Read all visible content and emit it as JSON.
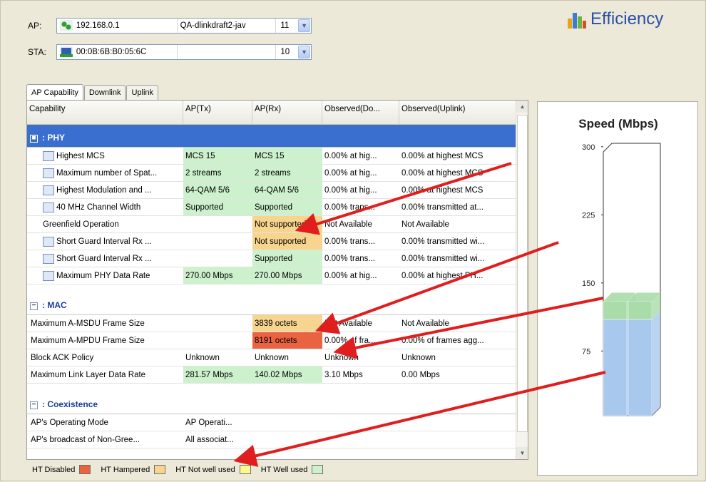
{
  "ap": {
    "label": "AP:",
    "ip": "192.168.0.1",
    "name": "QA-dlinkdraft2-jav",
    "channel": "11"
  },
  "sta": {
    "label": "STA:",
    "mac": "00:0B:6B:B0:05:6C",
    "name": "",
    "channel": "10"
  },
  "brand": {
    "title": "Efficiency"
  },
  "tabs": [
    {
      "label": "AP Capability"
    },
    {
      "label": "Downlink"
    },
    {
      "label": "Uplink"
    }
  ],
  "columns": [
    "Capability",
    "AP(Tx)",
    "AP(Rx)",
    "Observed(Do...",
    "Observed(Uplink)"
  ],
  "sections": {
    "phy": {
      "title": ": PHY"
    },
    "mac": {
      "title": ": MAC"
    },
    "coex": {
      "title": ": Coexistence"
    }
  },
  "phy_rows": [
    {
      "cap": "Highest MCS",
      "tx": "MCS 15",
      "rx": "MCS 15",
      "obs_down": "0.00% at hig...",
      "obs_up": "0.00% at highest MCS",
      "icon": true,
      "tx_c": "green",
      "rx_c": "green"
    },
    {
      "cap": "Maximum number of Spat...",
      "tx": "2 streams",
      "rx": "2 streams",
      "obs_down": "0.00% at hig...",
      "obs_up": "0.00% at highest MCS",
      "icon": true,
      "tx_c": "green",
      "rx_c": "green"
    },
    {
      "cap": "Highest Modulation and ...",
      "tx": "64-QAM 5/6",
      "rx": "64-QAM 5/6",
      "obs_down": "0.00% at hig...",
      "obs_up": "0.00% at highest MCS",
      "icon": true,
      "tx_c": "green",
      "rx_c": "green"
    },
    {
      "cap": "40 MHz Channel Width",
      "tx": "Supported",
      "rx": "Supported",
      "obs_down": "0.00% trans...",
      "obs_up": "0.00% transmitted at...",
      "icon": true,
      "tx_c": "green",
      "rx_c": "green"
    },
    {
      "cap": "Greenfield Operation",
      "tx": "",
      "rx": "Not supported",
      "obs_down": "Not Available",
      "obs_up": "Not Available",
      "icon": false,
      "tx_c": "",
      "rx_c": "orange"
    },
    {
      "cap": "Short Guard Interval Rx ...",
      "tx": "",
      "rx": "Not supported",
      "obs_down": "0.00% trans...",
      "obs_up": "0.00% transmitted wi...",
      "icon": true,
      "tx_c": "",
      "rx_c": "orange"
    },
    {
      "cap": "Short Guard Interval Rx ...",
      "tx": "",
      "rx": "Supported",
      "obs_down": "0.00% trans...",
      "obs_up": "0.00% transmitted wi...",
      "icon": true,
      "tx_c": "",
      "rx_c": "green"
    },
    {
      "cap": "Maximum PHY Data Rate",
      "tx": "270.00 Mbps",
      "rx": "270.00 Mbps",
      "obs_down": "0.00% at hig...",
      "obs_up": "0.00% at highest PH...",
      "icon": true,
      "tx_c": "green",
      "rx_c": "green"
    }
  ],
  "mac_rows": [
    {
      "cap": "Maximum A-MSDU Frame Size",
      "tx": "",
      "rx": "3839 octets",
      "obs_down": "Not Available",
      "obs_up": "Not Available",
      "tx_c": "",
      "rx_c": "orange"
    },
    {
      "cap": "Maximum A-MPDU Frame Size",
      "tx": "",
      "rx": "8191 octets",
      "obs_down": "0.00% of fra...",
      "obs_up": "0.00% of frames agg...",
      "tx_c": "",
      "rx_c": "red"
    },
    {
      "cap": "Block ACK Policy",
      "tx": "Unknown",
      "rx": "Unknown",
      "obs_down": "Unknown",
      "obs_up": "Unknown",
      "tx_c": "",
      "rx_c": ""
    },
    {
      "cap": "Maximum Link Layer Data Rate",
      "tx": "281.57 Mbps",
      "rx": "140.02 Mbps",
      "obs_down": "3.10 Mbps",
      "obs_up": "0.00 Mbps",
      "tx_c": "green",
      "rx_c": "green"
    }
  ],
  "coex_rows": [
    {
      "cap": "AP's Operating Mode",
      "tx": "AP Operati...",
      "rx": "",
      "obs_down": "",
      "obs_up": "",
      "tx_c": "",
      "rx_c": ""
    },
    {
      "cap": "AP's broadcast of Non-Gree...",
      "tx": "All associat...",
      "rx": "",
      "obs_down": "",
      "obs_up": "",
      "tx_c": "",
      "rx_c": ""
    }
  ],
  "legend": [
    {
      "label": "HT Disabled",
      "color": "#ea6240"
    },
    {
      "label": "HT Hampered",
      "color": "#f7d58e"
    },
    {
      "label": "HT Not well used",
      "color": "#fafa8c"
    },
    {
      "label": "HT Well used",
      "color": "#cdf0cd"
    }
  ],
  "chart_data": {
    "type": "bar",
    "title": "Speed (Mbps)",
    "ylim": [
      0,
      300
    ],
    "yticks": [
      75,
      150,
      225,
      300
    ],
    "categories": [
      "",
      ""
    ],
    "series": [
      {
        "values": [
          106,
          106
        ],
        "color": "#a9c8ee"
      },
      {
        "values": [
          20,
          20
        ],
        "color": "#a9dca9"
      }
    ],
    "grid": false
  },
  "colors": {
    "accent": "#2a4fa8",
    "section_header": "#3a6ecf",
    "arrow": "#e01e1e"
  }
}
